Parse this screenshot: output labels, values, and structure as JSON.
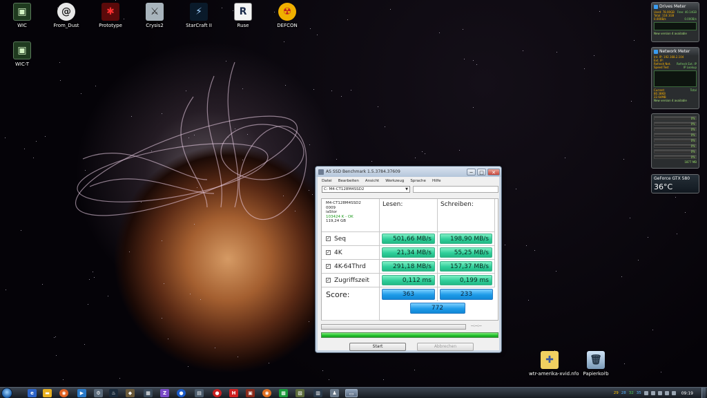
{
  "desktop": {
    "icons": [
      {
        "label": "WIC"
      },
      {
        "label": "From_Dust"
      },
      {
        "label": "Prototype"
      },
      {
        "label": "Crysis2"
      },
      {
        "label": "StarCraft II"
      },
      {
        "label": "Ruse"
      },
      {
        "label": "DEFCON"
      },
      {
        "label": "WIC-T"
      },
      {
        "label": "wtr-amerika-xvid.nfo"
      },
      {
        "label": "Papierkorb"
      }
    ]
  },
  "gadgets": {
    "drives_meter": {
      "title": "Drives Meter",
      "used": "Used: 78.00GB",
      "free": "Free: 40.14GB",
      "total": "Total: 118.1GB",
      "read": "0.000B/s",
      "write": "0.000B/s",
      "link": "New version 4 available"
    },
    "network_meter": {
      "title": "Network Meter",
      "int_ip": "Int. IP: 192.168.2.104",
      "ext_ip": "Ext. IP:",
      "refresh_net": "Refresh Net.",
      "refresh_ext": "Refresh Ext. IP",
      "speed_test": "Speed Test",
      "ip_lookup": "IP Lookup",
      "current": "Current",
      "total": "Total",
      "up": "80.38KB",
      "down": "22.64MB",
      "link": "New version 4 available"
    },
    "cpu_meter": {
      "cores": [
        "0%",
        "0%",
        "0%",
        "0%",
        "0%",
        "0%",
        "0%",
        "0%"
      ],
      "mem": "1877 MB"
    },
    "gpu": {
      "name": "GeForce GTX 580",
      "temp": "36°C"
    }
  },
  "window": {
    "title": "AS SSD Benchmark 1.5.3784.37609",
    "controls": {
      "minimize": "─",
      "maximize": "□",
      "close": "✕"
    },
    "menu": [
      "Datei",
      "Bearbeiten",
      "Ansicht",
      "Werkzeug",
      "Sprache",
      "Hilfe"
    ],
    "drive_select": "C: M4-CT128M4SSD2",
    "info": {
      "model": "M4-CT128M4SSD2",
      "firmware": "0009",
      "driver": "iaStor",
      "alignment": "103424 K - OK",
      "size": "119,24 GB"
    },
    "headers": {
      "read": "Lesen:",
      "write": "Schreiben:"
    },
    "rows": [
      {
        "label": "Seq",
        "read": "501,66 MB/s",
        "write": "198,90 MB/s",
        "checked": "✓"
      },
      {
        "label": "4K",
        "read": "21,34 MB/s",
        "write": "55,25 MB/s",
        "checked": "✓"
      },
      {
        "label": "4K-64Thrd",
        "read": "291,18 MB/s",
        "write": "157,37 MB/s",
        "checked": "✓"
      },
      {
        "label": "Zugriffszeit",
        "read": "0,112 ms",
        "write": "0,199 ms",
        "checked": "✓"
      }
    ],
    "score": {
      "label": "Score:",
      "read": "363",
      "write": "233",
      "total": "772"
    },
    "elapsed": "--:--:--",
    "progress_fraction": 1.0,
    "buttons": {
      "start": "Start",
      "abort": "Abbrechen"
    }
  },
  "taskbar": {
    "tray_numbers": [
      "29",
      "28",
      "32",
      "35"
    ],
    "clock": "09:19"
  }
}
